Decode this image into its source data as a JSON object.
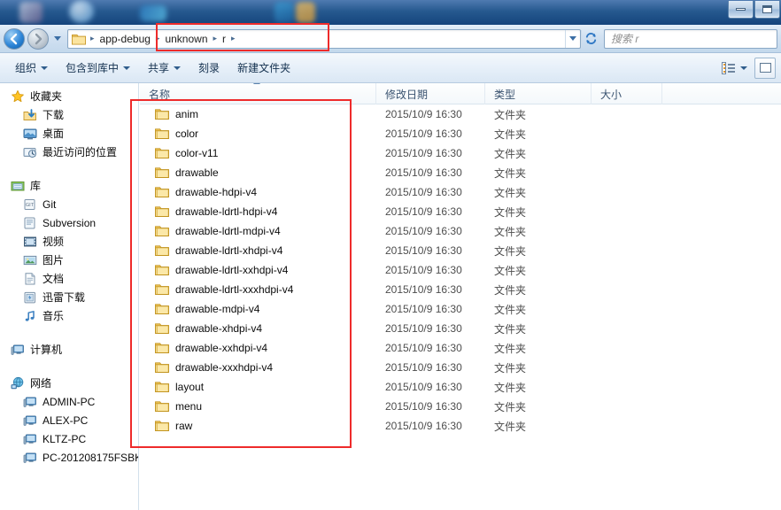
{
  "window": {
    "controls": [
      {
        "name": "minimize",
        "glyph": "minimize-glyph"
      },
      {
        "name": "maximize",
        "glyph": "maximize-glyph"
      }
    ]
  },
  "navbar": {
    "back_label": "←",
    "forward_label": "→",
    "breadcrumb": [
      {
        "label": "app-debug"
      },
      {
        "label": "unknown"
      },
      {
        "label": "r"
      }
    ],
    "separator": "▸",
    "refresh_label": "↻"
  },
  "search": {
    "placeholder": "搜索 r"
  },
  "toolbar": {
    "items": [
      {
        "label": "组织",
        "has_caret": true
      },
      {
        "label": "包含到库中",
        "has_caret": true
      },
      {
        "label": "共享",
        "has_caret": true
      },
      {
        "label": "刻录",
        "has_caret": false
      },
      {
        "label": "新建文件夹",
        "has_caret": false
      }
    ]
  },
  "sidebar": {
    "groups": [
      {
        "root": {
          "label": "收藏夹",
          "icon": "star-icon"
        },
        "items": [
          {
            "label": "下载",
            "icon": "downloads-icon"
          },
          {
            "label": "桌面",
            "icon": "desktop-icon"
          },
          {
            "label": "最近访问的位置",
            "icon": "recent-places-icon"
          }
        ]
      },
      {
        "root": {
          "label": "库",
          "icon": "library-icon"
        },
        "items": [
          {
            "label": "Git",
            "icon": "git-icon"
          },
          {
            "label": "Subversion",
            "icon": "subversion-icon"
          },
          {
            "label": "视频",
            "icon": "video-icon"
          },
          {
            "label": "图片",
            "icon": "pictures-icon"
          },
          {
            "label": "文档",
            "icon": "documents-icon"
          },
          {
            "label": "迅雷下载",
            "icon": "thunder-download-icon"
          },
          {
            "label": "音乐",
            "icon": "music-icon"
          }
        ]
      },
      {
        "root": {
          "label": "计算机",
          "icon": "computer-icon"
        },
        "items": []
      },
      {
        "root": {
          "label": "网络",
          "icon": "network-icon"
        },
        "items": [
          {
            "label": "ADMIN-PC",
            "icon": "computer-icon"
          },
          {
            "label": "ALEX-PC",
            "icon": "computer-icon"
          },
          {
            "label": "KLTZ-PC",
            "icon": "computer-icon"
          },
          {
            "label": "PC-201208175FSBK",
            "icon": "computer-icon"
          }
        ]
      }
    ]
  },
  "file_list": {
    "columns": [
      {
        "key": "name",
        "label": "名称"
      },
      {
        "key": "date",
        "label": "修改日期"
      },
      {
        "key": "type",
        "label": "类型"
      },
      {
        "key": "size",
        "label": "大小"
      }
    ],
    "sort_column": "name",
    "sort_direction": "ascending",
    "rows": [
      {
        "name": "anim",
        "date": "2015/10/9 16:30",
        "type": "文件夹",
        "size": ""
      },
      {
        "name": "color",
        "date": "2015/10/9 16:30",
        "type": "文件夹",
        "size": ""
      },
      {
        "name": "color-v11",
        "date": "2015/10/9 16:30",
        "type": "文件夹",
        "size": ""
      },
      {
        "name": "drawable",
        "date": "2015/10/9 16:30",
        "type": "文件夹",
        "size": ""
      },
      {
        "name": "drawable-hdpi-v4",
        "date": "2015/10/9 16:30",
        "type": "文件夹",
        "size": ""
      },
      {
        "name": "drawable-ldrtl-hdpi-v4",
        "date": "2015/10/9 16:30",
        "type": "文件夹",
        "size": ""
      },
      {
        "name": "drawable-ldrtl-mdpi-v4",
        "date": "2015/10/9 16:30",
        "type": "文件夹",
        "size": ""
      },
      {
        "name": "drawable-ldrtl-xhdpi-v4",
        "date": "2015/10/9 16:30",
        "type": "文件夹",
        "size": ""
      },
      {
        "name": "drawable-ldrtl-xxhdpi-v4",
        "date": "2015/10/9 16:30",
        "type": "文件夹",
        "size": ""
      },
      {
        "name": "drawable-ldrtl-xxxhdpi-v4",
        "date": "2015/10/9 16:30",
        "type": "文件夹",
        "size": ""
      },
      {
        "name": "drawable-mdpi-v4",
        "date": "2015/10/9 16:30",
        "type": "文件夹",
        "size": ""
      },
      {
        "name": "drawable-xhdpi-v4",
        "date": "2015/10/9 16:30",
        "type": "文件夹",
        "size": ""
      },
      {
        "name": "drawable-xxhdpi-v4",
        "date": "2015/10/9 16:30",
        "type": "文件夹",
        "size": ""
      },
      {
        "name": "drawable-xxxhdpi-v4",
        "date": "2015/10/9 16:30",
        "type": "文件夹",
        "size": ""
      },
      {
        "name": "layout",
        "date": "2015/10/9 16:30",
        "type": "文件夹",
        "size": ""
      },
      {
        "name": "menu",
        "date": "2015/10/9 16:30",
        "type": "文件夹",
        "size": ""
      },
      {
        "name": "raw",
        "date": "2015/10/9 16:30",
        "type": "文件夹",
        "size": ""
      }
    ]
  },
  "annotations": [
    {
      "name": "breadcrumb-highlight",
      "color": "#ee2b2b"
    },
    {
      "name": "file-list-highlight",
      "color": "#ee2b2b"
    }
  ],
  "colors": {
    "annotation_red": "#ee2b2b",
    "folder_yellow": "#f8d57e",
    "chrome_blue": "#d3e2f2",
    "desktop_blue": "#26598f"
  }
}
